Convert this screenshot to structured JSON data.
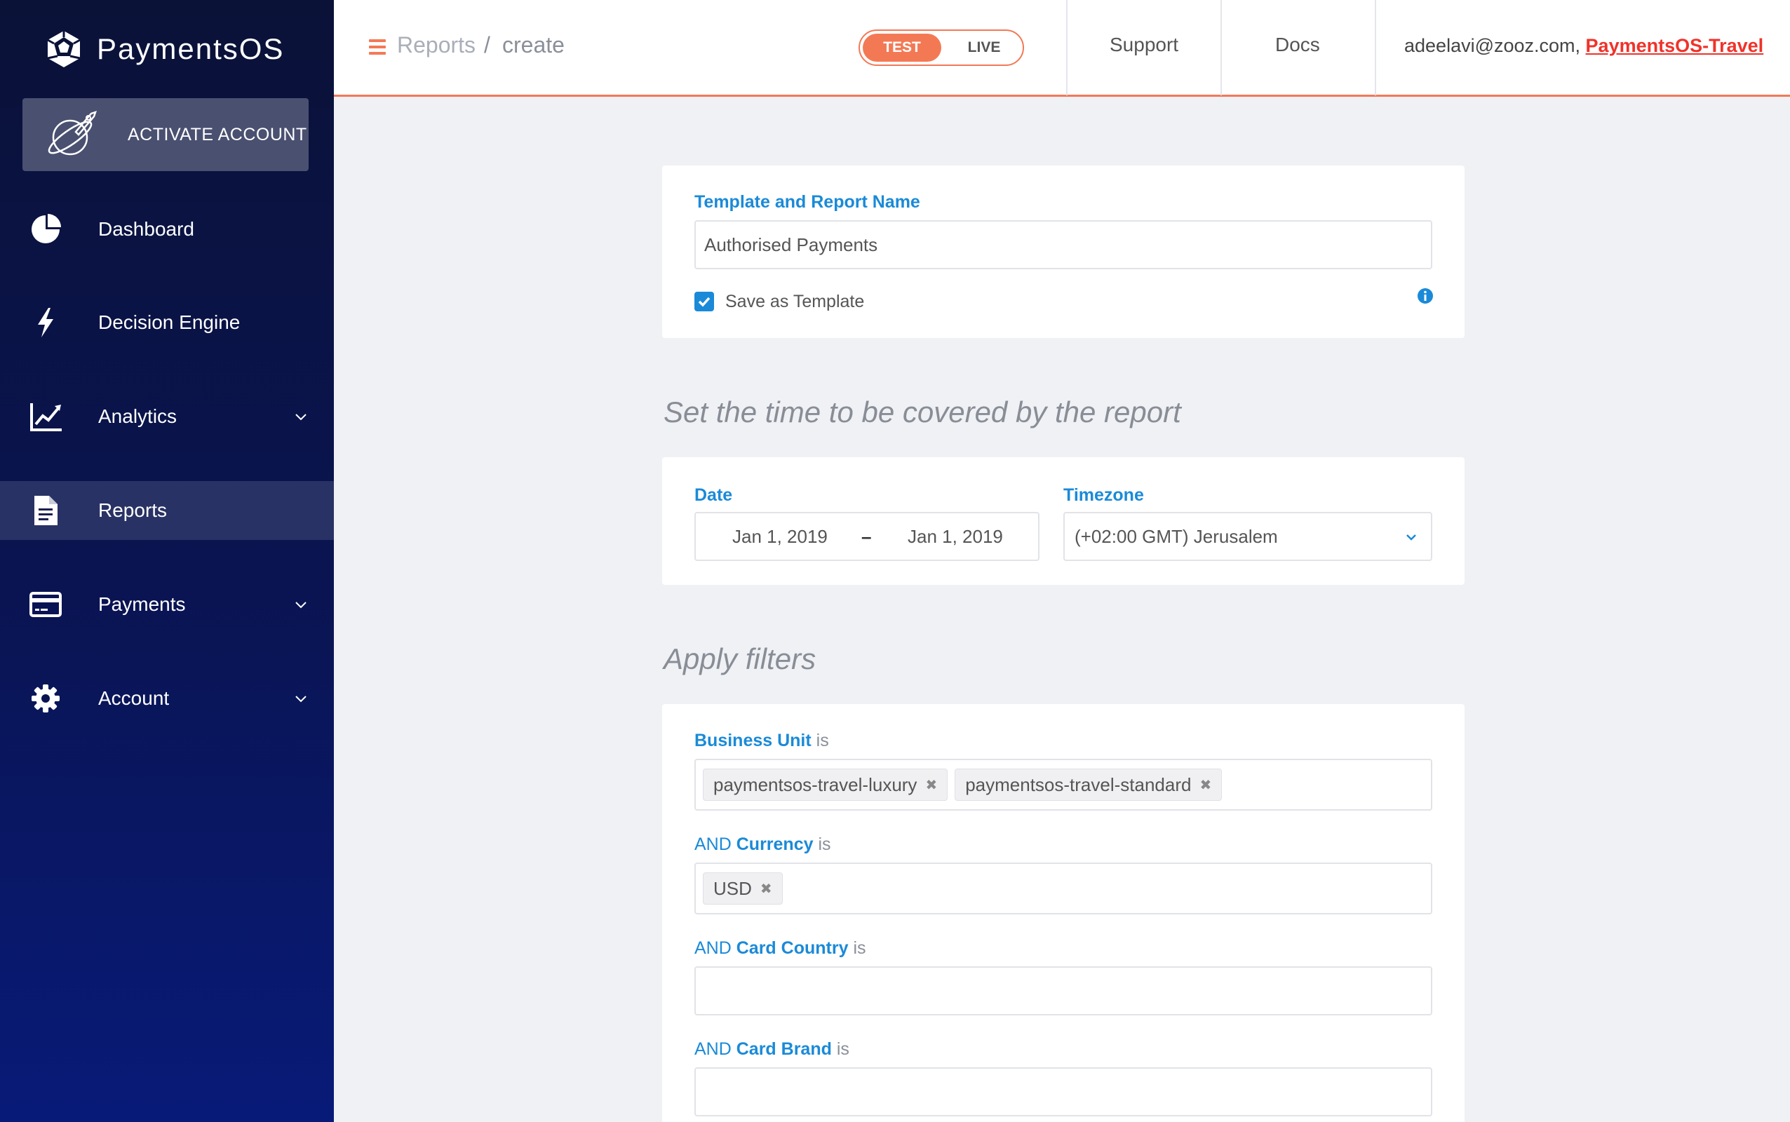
{
  "brand": {
    "name": "PaymentsOS",
    "accent": "#f37955",
    "link_blue": "#1a8ad8",
    "org_red": "#f0322a"
  },
  "sidebar": {
    "activate_label": "ACTIVATE ACCOUNT",
    "items": [
      {
        "label": "Dashboard",
        "icon": "pie-chart-icon",
        "has_chevron": false,
        "active": false
      },
      {
        "label": "Decision Engine",
        "icon": "lightning-icon",
        "has_chevron": false,
        "active": false
      },
      {
        "label": "Analytics",
        "icon": "line-chart-icon",
        "has_chevron": true,
        "active": false
      },
      {
        "label": "Reports",
        "icon": "document-icon",
        "has_chevron": false,
        "active": true
      },
      {
        "label": "Payments",
        "icon": "credit-card-icon",
        "has_chevron": true,
        "active": false
      },
      {
        "label": "Account",
        "icon": "gear-icon",
        "has_chevron": true,
        "active": false
      }
    ]
  },
  "header": {
    "breadcrumb": {
      "parent": "Reports",
      "separator": "/",
      "current": "create"
    },
    "env": {
      "test": "TEST",
      "live": "LIVE",
      "selected": "TEST"
    },
    "links": {
      "support": "Support",
      "docs": "Docs"
    },
    "user": {
      "email": "adeelavi@zooz.com,",
      "org": "PaymentsOS-Travel"
    }
  },
  "report_name": {
    "label": "Template and Report Name",
    "value": "Authorised Payments",
    "save_template_label": "Save as Template",
    "save_template_checked": true
  },
  "time_section": {
    "heading": "Set the time to be covered by the report",
    "date_label": "Date",
    "date_from": "Jan 1, 2019",
    "date_sep": "–",
    "date_to": "Jan 1, 2019",
    "timezone_label": "Timezone",
    "timezone_value": "(+02:00 GMT) Jerusalem"
  },
  "filters": {
    "heading": "Apply filters",
    "and": "AND",
    "is": "is",
    "business_unit": {
      "label": "Business Unit",
      "chips": [
        "paymentsos-travel-luxury",
        "paymentsos-travel-standard"
      ]
    },
    "currency": {
      "label": "Currency",
      "chips": [
        "USD"
      ]
    },
    "card_country": {
      "label": "Card Country"
    },
    "card_brand": {
      "label": "Card Brand"
    }
  }
}
